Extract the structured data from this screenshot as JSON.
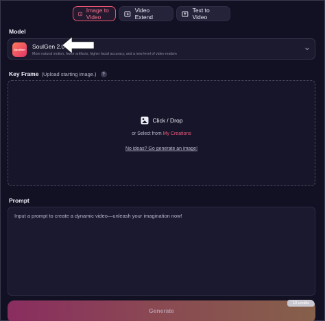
{
  "tabs": [
    {
      "label": "Image to Video",
      "icon": "image-video-icon",
      "active": true
    },
    {
      "label": "Video Extend",
      "icon": "video-extend-icon",
      "active": false
    },
    {
      "label": "Text to Video",
      "icon": "text-video-icon",
      "active": false
    }
  ],
  "model": {
    "section_label": "Model",
    "name": "SoulGen 2.0",
    "logo_text": "SoulGen",
    "description": "More natural motion, fewer artifacts, higher facial accuracy, and a new level of video realism"
  },
  "key_frame": {
    "section_label": "Key Frame",
    "hint": "(Upload starting image.)",
    "help_text": "?",
    "upload_label": "Click / Drop",
    "select_prefix": "or Select from",
    "select_link": "My Creations",
    "generate_link": "No ideas? Go generate an image!"
  },
  "prompt": {
    "section_label": "Prompt",
    "placeholder": "Input a prompt to create a dynamic video—unleash your imagination now!"
  },
  "generate": {
    "label": "Generate",
    "credits": "10 credits"
  },
  "colors": {
    "accent": "#ee5a7c",
    "background": "#121124",
    "panel": "#1b1a2e"
  }
}
